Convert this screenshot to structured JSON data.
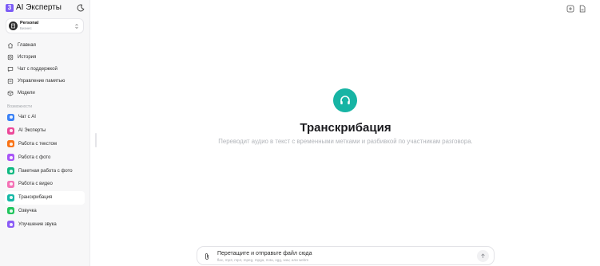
{
  "brand": {
    "logo_char": "3",
    "name": "AI Эксперты"
  },
  "account": {
    "name": "Personal",
    "plan": "Бизнес"
  },
  "nav": {
    "items": [
      {
        "label": "Главная",
        "icon": "home-icon"
      },
      {
        "label": "История",
        "icon": "history-icon"
      },
      {
        "label": "Чат с поддержкой",
        "icon": "chat-icon"
      },
      {
        "label": "Управление памятью",
        "icon": "memory-icon"
      },
      {
        "label": "Модели",
        "icon": "cube-icon"
      }
    ]
  },
  "features": {
    "section_label": "Возможности",
    "items": [
      {
        "label": "Чат с AI",
        "color": "#3b82f6"
      },
      {
        "label": "AI Эксперты",
        "color": "#ec4899"
      },
      {
        "label": "Работа с текстом",
        "color": "#f97316"
      },
      {
        "label": "Работа с фото",
        "color": "#a855f7"
      },
      {
        "label": "Пакетная работа с фото",
        "color": "#10b981"
      },
      {
        "label": "Работа с видео",
        "color": "#f472b6"
      },
      {
        "label": "Транскрибация",
        "color": "#14b8a6",
        "active": true
      },
      {
        "label": "Озвучка",
        "color": "#22c55e"
      },
      {
        "label": "Улучшение звука",
        "color": "#8b5cf6"
      }
    ]
  },
  "main": {
    "title": "Транскрибация",
    "subtitle": "Переводит аудио в текст с временными метками и разбивкой по участникам разговора.",
    "icon": "headphones-icon",
    "accent": "#17b4a4"
  },
  "upload": {
    "title": "Перетащите и отправьте файл сюда",
    "formats": "flac, mp3, mp4, mpeg, mpga, m4a, ogg, wav, или webm"
  }
}
